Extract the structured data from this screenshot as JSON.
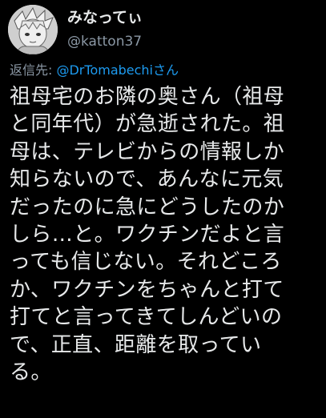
{
  "tweet": {
    "display_name": "みなってぃ",
    "handle": "@katton37",
    "reply_prefix": "返信先: ",
    "reply_mention": "@DrTomabechiさん",
    "body_lines": [
      "祖母宅のお隣の奥さん（祖母",
      "と同年代）が急逝された。祖",
      "母は、テレビからの情報しか",
      "知らないので、あんなに元気",
      "だったのに急にどうしたのか",
      "しら…と。ワクチンだよと言",
      "っても信じない。それどころ",
      "か、ワクチンをちゃんと打て",
      "打てと言ってきてしんどいの",
      "で、正直、距離を取ってい",
      "る。"
    ]
  },
  "colors": {
    "background": "#000000",
    "text": "#e7e9ea",
    "secondary": "#8b98a5",
    "link": "#1d9bf0"
  }
}
